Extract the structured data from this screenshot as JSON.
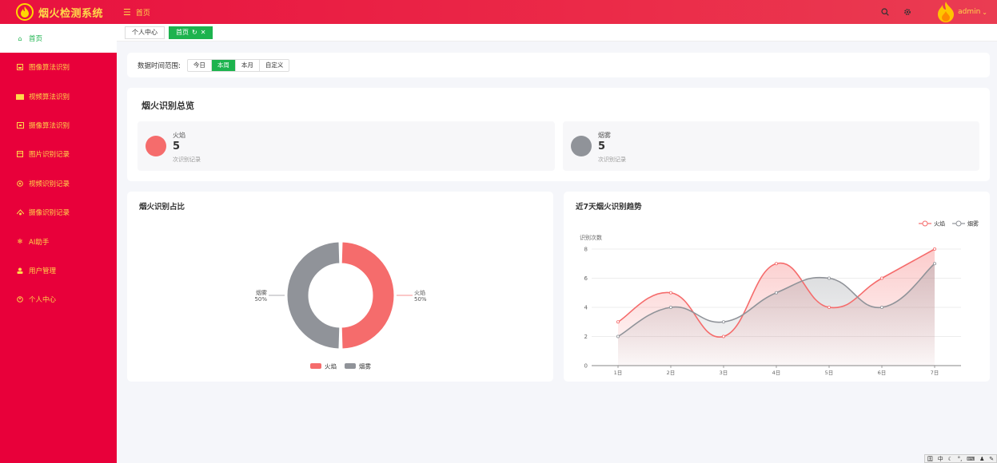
{
  "app": {
    "title": "烟火检测系统"
  },
  "header": {
    "breadcrumb": "首页",
    "user": "admin"
  },
  "sidebar": {
    "items": [
      {
        "label": "首页",
        "icon": "home-icon",
        "active": true
      },
      {
        "label": "图像算法识别",
        "icon": "image-icon"
      },
      {
        "label": "视频算法识别",
        "icon": "video-icon"
      },
      {
        "label": "摄像算法识别",
        "icon": "camera-icon"
      },
      {
        "label": "图片识别记录",
        "icon": "picture-record-icon"
      },
      {
        "label": "视频识别记录",
        "icon": "video-record-icon"
      },
      {
        "label": "摄像识别记录",
        "icon": "camera-record-icon"
      },
      {
        "label": "AI助手",
        "icon": "ai-icon"
      },
      {
        "label": "用户管理",
        "icon": "user-icon"
      },
      {
        "label": "个人中心",
        "icon": "profile-icon"
      }
    ]
  },
  "tabs": [
    {
      "label": "个人中心",
      "active": false
    },
    {
      "label": "首页",
      "active": true
    }
  ],
  "filter": {
    "label": "数据时间范围:",
    "options": [
      "今日",
      "本周",
      "本月",
      "自定义"
    ],
    "selected": "本周"
  },
  "overview": {
    "title": "烟火识别总览",
    "stats": [
      {
        "name": "火焰",
        "value": "5",
        "unit": "次识别记录",
        "color": "#f56c6c"
      },
      {
        "name": "烟雾",
        "value": "5",
        "unit": "次识别记录",
        "color": "#909399"
      }
    ]
  },
  "colors": {
    "fire": "#f56c6c",
    "smoke": "#909399",
    "accent": "#1db34e",
    "sidebar": "#e8003a"
  },
  "chart_data": [
    {
      "type": "pie",
      "title": "烟火识别占比",
      "categories": [
        "火焰",
        "烟雾"
      ],
      "values": [
        50,
        50
      ],
      "labels": [
        {
          "name": "火焰",
          "percent": "50%"
        },
        {
          "name": "烟雾",
          "percent": "50%"
        }
      ],
      "legend": [
        "火焰",
        "烟雾"
      ],
      "legend_position": "bottom"
    },
    {
      "type": "area",
      "title": "近7天烟火识别趋势",
      "ylabel": "识别次数",
      "x": [
        "1日",
        "2日",
        "3日",
        "4日",
        "5日",
        "6日",
        "7日"
      ],
      "series": [
        {
          "name": "火焰",
          "values": [
            3,
            5,
            2,
            7,
            4,
            6,
            8
          ]
        },
        {
          "name": "烟雾",
          "values": [
            2,
            4,
            3,
            5,
            6,
            4,
            7
          ]
        }
      ],
      "ylim": [
        0,
        8
      ],
      "yticks": [
        "0",
        "2",
        "4",
        "6",
        "8"
      ],
      "legend_position": "top-right",
      "grid": true
    }
  ]
}
